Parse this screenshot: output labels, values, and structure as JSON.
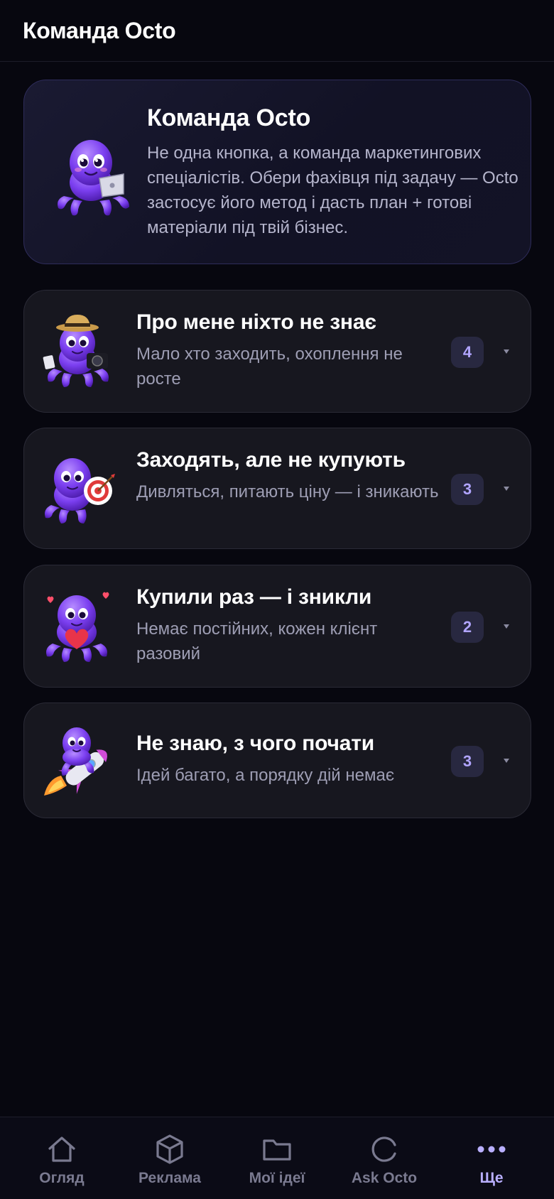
{
  "header": {
    "title": "Команда Octo"
  },
  "intro": {
    "title": "Команда Octo",
    "description": "Не одна кнопка, а команда маркетингових спеціалістів. Обери фахівця під задачу — Octo застосує його метод і дасть план + готові матеріали під твій бізнес.",
    "mascot_icon": "octopus-laptop-icon"
  },
  "cards": [
    {
      "title": "Про мене ніхто не знає",
      "subtitle": "Мало хто заходить, охоплення не росте",
      "count": "4",
      "mascot_icon": "octopus-photographer-icon"
    },
    {
      "title": "Заходять, але не купують",
      "subtitle": "Дивляться, питають ціну — і зникають",
      "count": "3",
      "mascot_icon": "octopus-target-icon"
    },
    {
      "title": "Купили раз — і зникли",
      "subtitle": "Немає постійних, кожен клієнт разовий",
      "count": "2",
      "mascot_icon": "octopus-heart-icon"
    },
    {
      "title": "Не знаю, з чого почати",
      "subtitle": "Ідей багато, а порядку дій немає",
      "count": "3",
      "mascot_icon": "octopus-rocket-icon"
    }
  ],
  "nav": {
    "items": [
      {
        "label": "Огляд",
        "icon": "home-icon"
      },
      {
        "label": "Реклама",
        "icon": "box-icon"
      },
      {
        "label": "Мої ідеї",
        "icon": "folder-icon"
      },
      {
        "label": "Ask Octo",
        "icon": "refresh-icon"
      },
      {
        "label": "Ще",
        "icon": "more-icon",
        "active": true
      }
    ]
  },
  "colors": {
    "background": "#07070f",
    "card": "#17171f",
    "accent": "#b1a5ff",
    "octopus": "#7b3ff0",
    "muted_text": "#9e9eb4"
  }
}
